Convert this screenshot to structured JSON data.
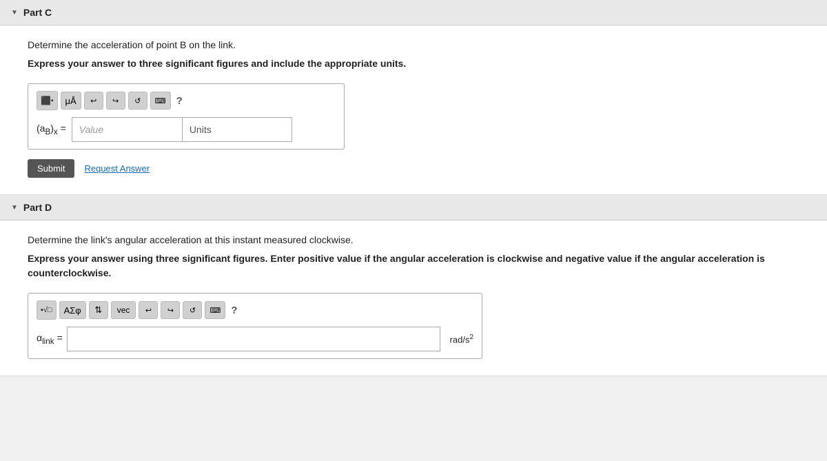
{
  "partC": {
    "header": "Part C",
    "instruction1": "Determine the acceleration of point B on the link.",
    "instruction2": "Express your answer to three significant figures and include the appropriate units.",
    "toolbar": {
      "btn1_label": "⬛▪",
      "btn2_label": "μÅ",
      "undo_label": "↩",
      "redo_label": "↪",
      "refresh_label": "↺",
      "keyboard_label": "⌨",
      "help_label": "?"
    },
    "input_label": "(aB)x =",
    "value_placeholder": "Value",
    "units_placeholder": "Units",
    "submit_label": "Submit",
    "request_label": "Request Answer"
  },
  "partD": {
    "header": "Part D",
    "instruction1": "Determine the link's angular acceleration at this instant measured clockwise.",
    "instruction2": "Express your answer using three significant figures. Enter positive value if the angular acceleration is clockwise and negative value if the angular acceleration is counterclockwise.",
    "toolbar": {
      "matrix_label": "▪√□",
      "greek_label": "ΑΣφ",
      "arrows_label": "⇅",
      "vec_label": "vec",
      "undo_label": "↩",
      "redo_label": "↪",
      "refresh_label": "↺",
      "keyboard_label": "⌨",
      "help_label": "?"
    },
    "omega_label": "αlink =",
    "unit_label": "rad/s²",
    "omega_value": ""
  }
}
